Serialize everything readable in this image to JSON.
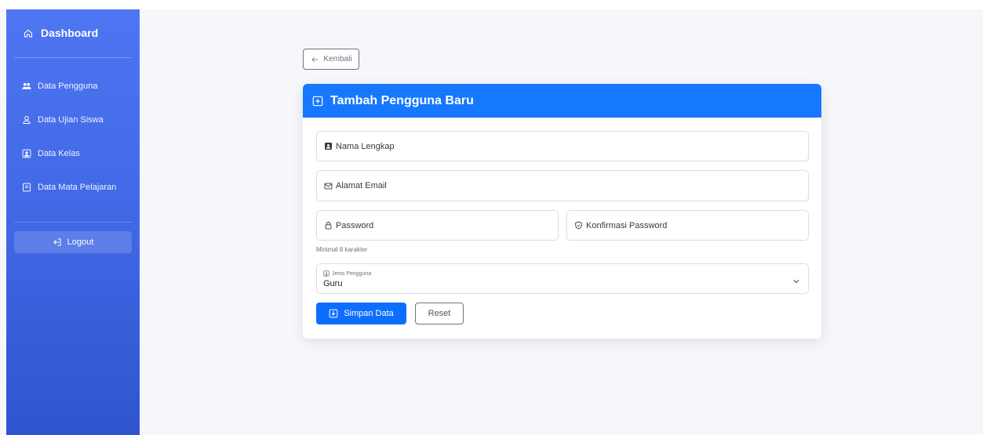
{
  "sidebar": {
    "brand": "Dashboard",
    "items": [
      {
        "label": "Data Pengguna",
        "icon": "users-icon"
      },
      {
        "label": "Data Ujian Siswa",
        "icon": "person-icon"
      },
      {
        "label": "Data Kelas",
        "icon": "class-icon"
      },
      {
        "label": "Data Mata Pelajaran",
        "icon": "book-icon"
      }
    ],
    "logout_label": "Logout"
  },
  "back_label": "Kembali",
  "form": {
    "title": "Tambah Pengguna Baru",
    "name_placeholder": "Nama Lengkap",
    "email_placeholder": "Alamat Email",
    "password_placeholder": "Password",
    "confirm_placeholder": "Konfirmasi Password",
    "password_hint": "Minimal 8 karakter",
    "role_label": "Jenis Pengguna",
    "role_value": "Guru",
    "save_label": "Simpan Data",
    "reset_label": "Reset"
  },
  "colors": {
    "sidebar": "#4e76f2",
    "primary": "#1677ff",
    "page_bg": "#f6f7fb"
  }
}
